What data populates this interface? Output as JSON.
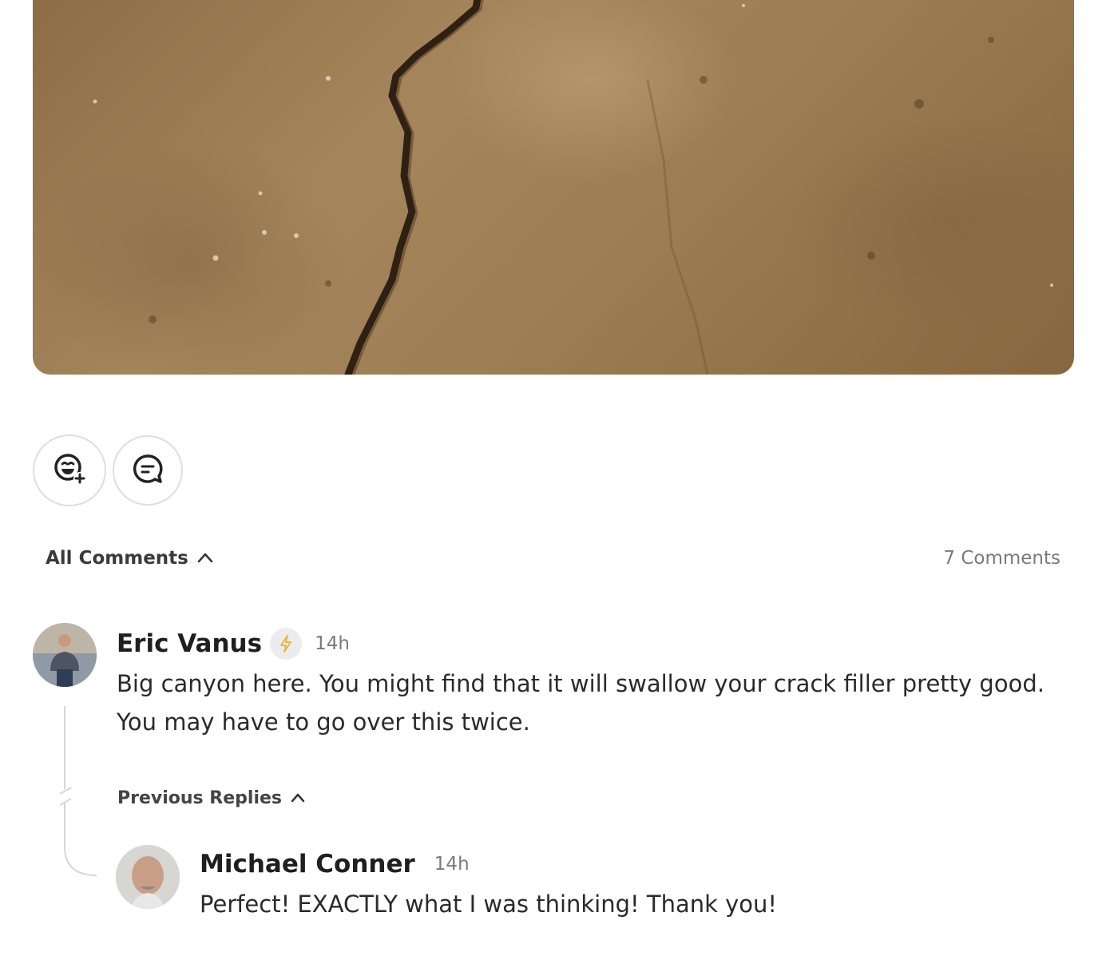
{
  "post": {
    "image_alt": "Concrete floor with a crack",
    "actions": {
      "react_icon": "add-reaction-icon",
      "comment_icon": "comment-bubble-icon"
    }
  },
  "comments_header": {
    "label": "All Comments",
    "count": "7 Comments"
  },
  "comment": {
    "author": "Eric Vanus",
    "badge_icon": "lightning-icon",
    "badge_color": "#e8b530",
    "time": "14h",
    "text": "Big canyon here. You might find that it will swallow your crack filler pretty good. You may have to go over this twice."
  },
  "previous_replies_label": "Previous Replies",
  "reply": {
    "author": "Michael Conner",
    "time": "14h",
    "text": "Perfect! EXACTLY what I was thinking! Thank you!"
  }
}
